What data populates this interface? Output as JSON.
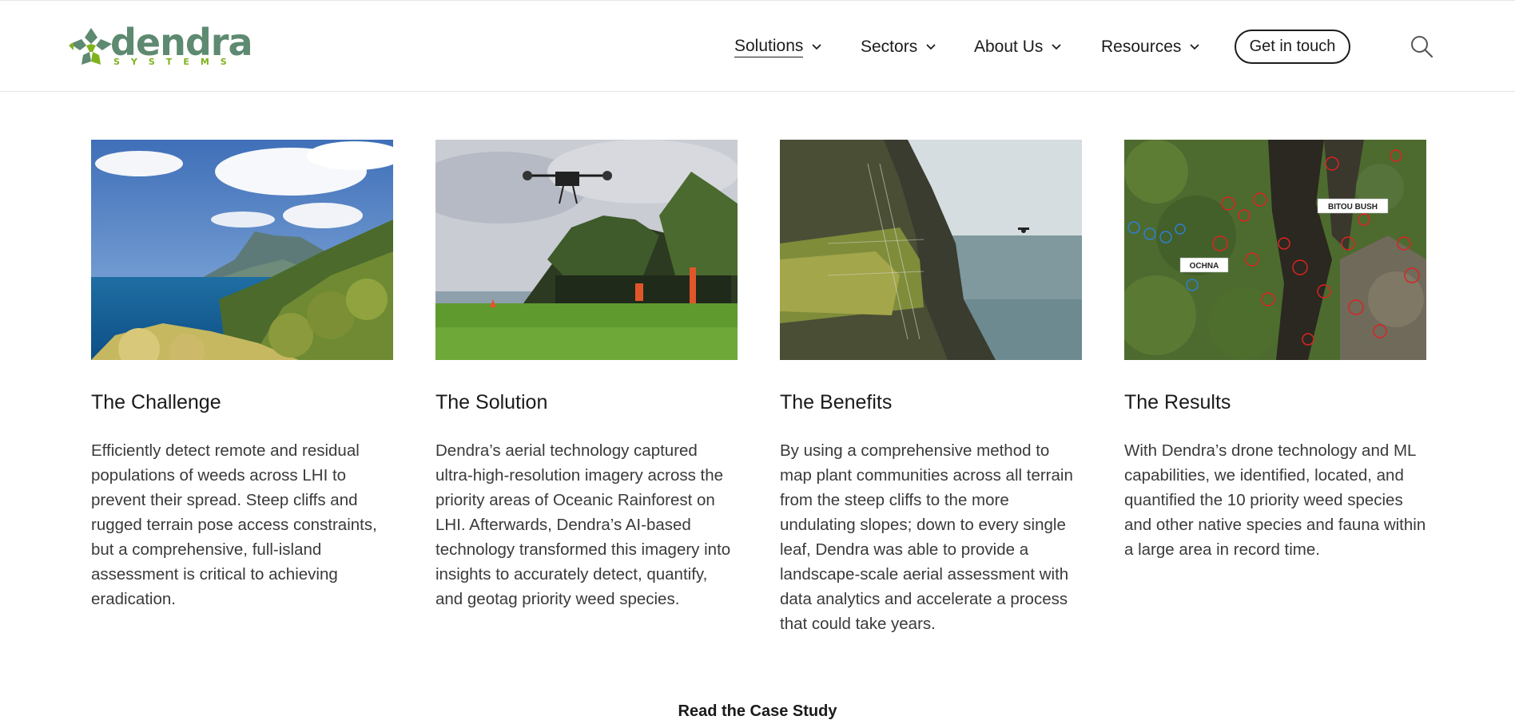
{
  "brand": {
    "name": "dendra",
    "tagline": "SYSTEMS"
  },
  "nav": {
    "items": [
      {
        "label": "Solutions",
        "active": true
      },
      {
        "label": "Sectors",
        "active": false
      },
      {
        "label": "About Us",
        "active": false
      },
      {
        "label": "Resources",
        "active": false
      }
    ],
    "cta_label": "Get in touch",
    "search_icon": "search-icon"
  },
  "cards": [
    {
      "title": "The Challenge",
      "body": "Efficiently detect remote and residual populations of weeds across LHI to prevent their spread. Steep cliffs and rugged terrain pose access constraints, but a comprehensive, full-island assessment is critical to achieving eradication.",
      "image": "coastal-island-landscape"
    },
    {
      "title": "The Solution",
      "body": "Dendra’s aerial technology captured ultra-high-resolution imagery across the priority areas of Oceanic Rainforest on LHI. Afterwards, Dendra’s AI-based technology transformed this imagery into insights to accurately detect, quantify, and geotag priority weed species.",
      "image": "drone-over-rainforest"
    },
    {
      "title": "The Benefits",
      "body": "By using a comprehensive method to map plant communities across all terrain from the steep cliffs to the more undulating slopes; down to every single leaf, Dendra was able to provide a landscape-scale aerial assessment with data analytics and accelerate a process that could take years.",
      "image": "drone-beside-cliff"
    },
    {
      "title": "The Results",
      "body": "With Dendra’s drone technology and ML capabilities, we identified, located, and quantified the 10 priority weed species and other native species and fauna within a large area in record time.",
      "image": "annotated-aerial-map",
      "labels": [
        "BITOU BUSH",
        "OCHNA"
      ]
    }
  ],
  "read_more_label": "Read the Case Study",
  "colors": {
    "brand_green": "#5d8a70",
    "accent_lime": "#7fb21d",
    "text": "#1c1c1c"
  }
}
